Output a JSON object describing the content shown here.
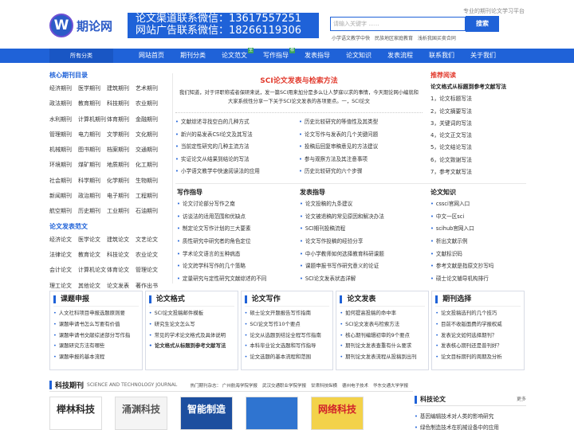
{
  "header": {
    "logo_text": "期论网",
    "banner_line1": "论文渠道联系微信：13617557251",
    "banner_line2": "网站广告联系微信：18266119306",
    "slogan": "专业的期刊论文学习平台",
    "search_placeholder": "请输入关键字 ......",
    "search_button": "搜索",
    "hot_links": [
      "小学语文教学中快",
      "民族地区家庭教育",
      "浅析我国买卖合同"
    ]
  },
  "nav": {
    "all_categories": "所有分类",
    "items": [
      {
        "label": "网站首页",
        "tag": ""
      },
      {
        "label": "期刊分类",
        "tag": ""
      },
      {
        "label": "论文范文",
        "tag": "全"
      },
      {
        "label": "写作指导",
        "tag": "荐"
      },
      {
        "label": "发表指导",
        "tag": ""
      },
      {
        "label": "论文知识",
        "tag": ""
      },
      {
        "label": "发表流程",
        "tag": ""
      },
      {
        "label": "联系我们",
        "tag": ""
      },
      {
        "label": "关于我们",
        "tag": ""
      }
    ]
  },
  "left": {
    "journals_title": "核心期刊目录",
    "journals": [
      "经济期刊",
      "医学期刊",
      "建筑期刊",
      "艺术期刊",
      "政法期刊",
      "教育期刊",
      "科技期刊",
      "农业期刊",
      "水利期刊",
      "计算机期刊",
      "体育期刊",
      "金融期刊",
      "管理期刊",
      "电力期刊",
      "文学期刊",
      "文化期刊",
      "机械期刊",
      "图书期刊",
      "档案期刊",
      "交通期刊",
      "环境期刊",
      "煤矿期刊",
      "地质期刊",
      "化工期刊",
      "社会期刊",
      "科学期刊",
      "化学期刊",
      "生物期刊",
      "新闻期刊",
      "政治期刊",
      "电子期刊",
      "工程期刊",
      "航空期刊",
      "历史期刊",
      "工业期刊",
      "石油期刊"
    ],
    "papers_title": "论文发表范文",
    "papers": [
      "经济论文",
      "医学论文",
      "建筑论文",
      "文艺论文",
      "法律论文",
      "教育论文",
      "科技论文",
      "农业论文",
      "会计论文",
      "计算机论文",
      "体育论文",
      "管理论文",
      "理工论文",
      "其他论文",
      "论文发表",
      "著作出书"
    ]
  },
  "center": {
    "title": "SCI论文发表与检索方法",
    "desc": "我们知道，对于评职称或者保研来说，发一篇SCI用来加分是多么让人梦寐以求的事情，今天期论网小编就和大家系统性分享一下关于SCI论文发表的各项要点。一，SCI论文",
    "list_left": [
      "文献综述寻找空白的几种方式",
      "新兴的易发表CSI论文及其写法",
      "当前定性研究的几种主流方法",
      "实证论文从结果到结论的写法",
      "小学语文教学中快速阅读法的应用"
    ],
    "list_right": [
      "历史比较研究的等值性及其类型",
      "论文写作与发表的几个关键问题",
      "投稿后回复审稿意见的方法建议",
      "参与观察方法及其注意事项",
      "历史比较研究的六个步骤"
    ]
  },
  "right": {
    "title": "推荐阅读",
    "items": [
      "论文格式从标题到参考文献写法",
      "1，论文标题写法",
      "2，论文摘要写法",
      "3，关键词的写法",
      "4，论文正文写法",
      "5，论文结论写法",
      "6，论文致谢写法",
      "7，参考文献写法"
    ]
  },
  "mid": [
    {
      "title": "写作指导",
      "items": [
        "论文讨论部分写作之南",
        "访谈法的适用范围和优缺点",
        "制定论文写作计划的三大要素",
        "质性研究中研究者的角色定位",
        "学术论文语言的五种病态",
        "论文跨学科写作的几个策略",
        "定量研究与定性研究文献综述的不同"
      ]
    },
    {
      "title": "发表指导",
      "items": [
        "论文投稿的九条建议",
        "论文被退稿的常见原因和解决办法",
        "SCI期刊投稿流程",
        "论文写作投稿的经验分享",
        "中小学教师如何选择教育科研课题",
        "课题申报书写作研究意义的论证",
        "SCI论文发表状态详解"
      ]
    },
    {
      "title": "论文知识",
      "items": [
        "cssci官网入口",
        "中文一区sci",
        "scihub官网入口",
        "析出文献示例",
        "文献标识码",
        "参考文献是指原文抄写吗",
        "硕士论文辅导机构排行"
      ]
    }
  ],
  "cards": [
    {
      "title": "课题申报",
      "items": [
        "人文社科项目申报选题原则要",
        "课题申请书怎么写要有价值",
        "课题申请书文献综述部分写作指",
        "课题研究方法有哪些",
        "课题申报的基本流程"
      ],
      "bold_index": -1
    },
    {
      "title": "论文格式",
      "items": [
        "SCI论文投稿邮件模板",
        "研究生论文怎么写",
        "常见的学术论文格式及具体说明",
        "论文格式从标题到参考文献写法"
      ],
      "bold_index": 3
    },
    {
      "title": "论文写作",
      "items": [
        "硕士论文开题报告写作指南",
        "SCI论文写作10个要点",
        "论文从选题到结论全程写作指南",
        "本科毕业论文选题和写作指导",
        "论文选题的基本流程和范围"
      ],
      "bold_index": -1
    },
    {
      "title": "论文发表",
      "items": [
        "如何提高投稿的命中率",
        "SCI论文发表与检索方法",
        "核心期刊编辑初审的9个要点",
        "期刊论文发表查重有什么要求",
        "期刊论文发表流程从投稿到出刊"
      ],
      "bold_index": -1
    },
    {
      "title": "期刊选择",
      "items": [
        "论文投稿选刊的几个技巧",
        "目前不收版面费的学报权威",
        "发表论文如何选择期刊？",
        "发表核心期刊还是普刊好？",
        "论文目标期刊的周期及分析"
      ],
      "bold_index": -1
    }
  ],
  "journals": {
    "title": "科技期刊",
    "subtitle": "SCIENCE AND TECHNOLOGY JOURNAL",
    "hot_label": "热门期刊杂志：",
    "hot_items": [
      "广州航海学院学报",
      "武汉交通职业学院学报",
      "甘肃科技纵横",
      "德州电子技术",
      "华东交通大学学报"
    ],
    "covers": [
      {
        "text": "榉林科技",
        "color": "#2b2b2b",
        "bg": "#ffffff"
      },
      {
        "text": "涌渊科技",
        "color": "#555555",
        "bg": "#f4f4f4"
      },
      {
        "text": "智能制造",
        "color": "#ffffff",
        "bg": "#1d4f9f"
      },
      {
        "text": "",
        "color": "#ffffff",
        "bg": "#2f74d0"
      },
      {
        "text": "网络科技",
        "color": "#d1202a",
        "bg": "#f3d24a"
      }
    ]
  },
  "tech_papers": {
    "title": "科技论文",
    "more": "更多",
    "items": [
      "基因编辑技术对人类的影响研究",
      "绿色制造技术在机械设备中的应用"
    ]
  },
  "colors": {
    "primary": "#1f62d8",
    "accent": "#e23b2e",
    "tag_green": "#3aa35e"
  }
}
